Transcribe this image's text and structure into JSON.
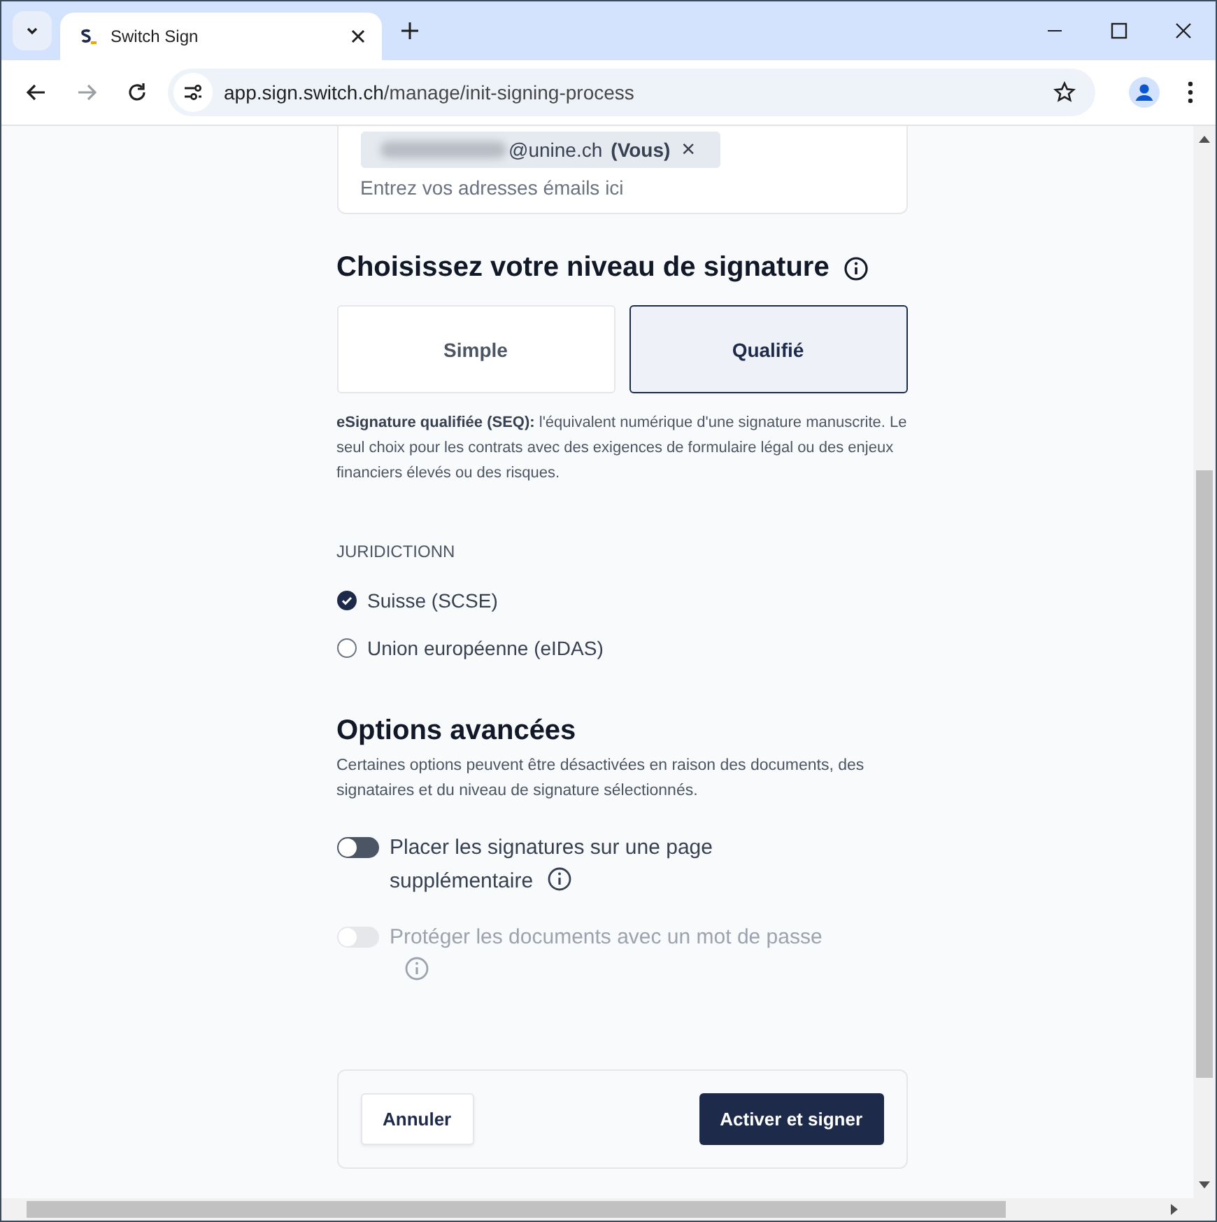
{
  "browser": {
    "tab_title": "Switch Sign",
    "url_host": "app.sign.switch.ch",
    "url_path": "/manage/init-signing-process"
  },
  "recipients": {
    "chips": [
      {
        "email": "@unine.ch",
        "redacted": true,
        "tag": "(Vous)",
        "remove": "×"
      }
    ],
    "placeholder": "Entrez vos adresses émails ici"
  },
  "signature_level": {
    "title": "Choisissez votre niveau de signature",
    "options": [
      {
        "label": "Simple",
        "selected": false
      },
      {
        "label": "Qualifié",
        "selected": true
      }
    ],
    "description": "**eSignature qualifiée (SEQ):** l'équivalent numérique d'une signature manuscrite. Le seul choix pour les contrats avec des exigences de formulaire légal ou des enjeux financiers élevés ou des risques."
  },
  "jurisdiction": {
    "label": "JURIDICTIONN",
    "options": [
      {
        "label": "Suisse (SCSE)",
        "selected": true
      },
      {
        "label": "Union européenne (eIDAS)",
        "selected": false
      }
    ]
  },
  "advanced": {
    "title": "Options avancées",
    "description": "Certaines options peuvent être désactivées en raison des documents, des signataires et du niveau de signature sélectionnés.",
    "options": [
      {
        "label": "Placer les signatures sur une page supplémentaire",
        "on": false,
        "disabled": false
      },
      {
        "label": "Protéger les documents avec un mot de passe",
        "on": false,
        "disabled": true
      }
    ]
  },
  "actions": {
    "cancel": "Annuler",
    "submit": "Activer et signer"
  }
}
